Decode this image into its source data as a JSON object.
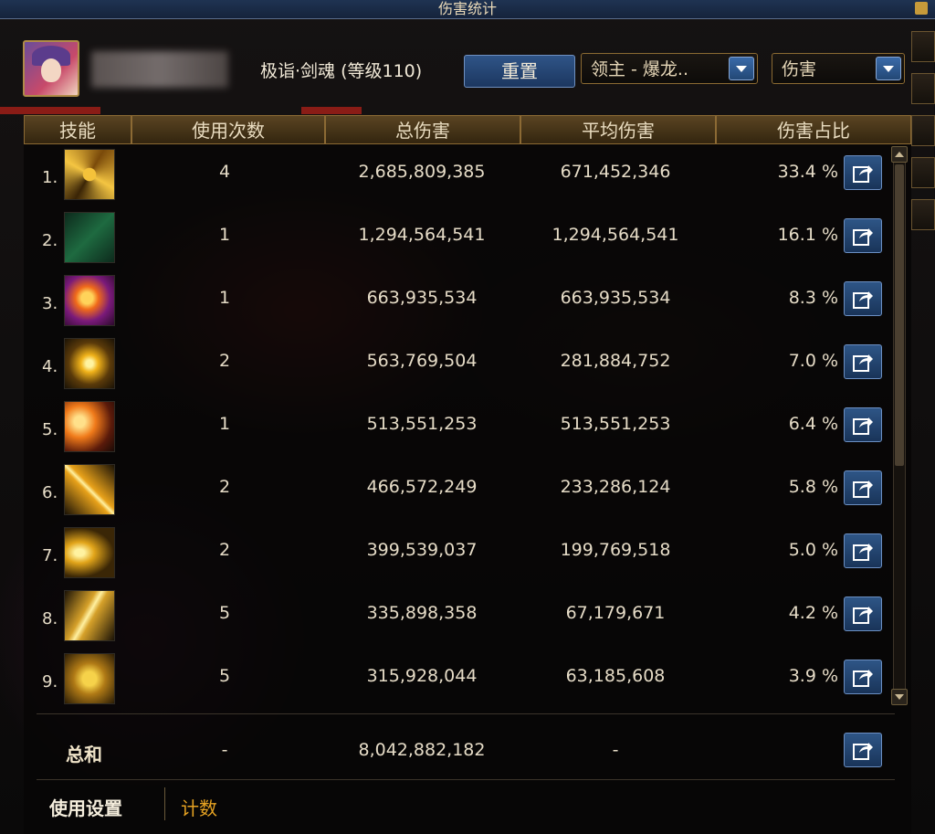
{
  "window": {
    "title": "伤害统计"
  },
  "character": {
    "name": "极诣·剑魂 (等级110)"
  },
  "header": {
    "reset_label": "重置",
    "target_dropdown": "领主 - 爆龙..",
    "stat_dropdown": "伤害"
  },
  "table": {
    "columns": [
      "技能",
      "使用次数",
      "总伤害",
      "平均伤害",
      "伤害占比"
    ],
    "rows": [
      {
        "index": "1.",
        "icon": "golden-slash-swirl-icon",
        "uses": "4",
        "total": "2,685,809,385",
        "avg": "671,452,346",
        "pct": "33.4 %"
      },
      {
        "index": "2.",
        "icon": "green-glyph-icon",
        "uses": "1",
        "total": "1,294,564,541",
        "avg": "1,294,564,541",
        "pct": "16.1 %"
      },
      {
        "index": "3.",
        "icon": "purple-burst-icon",
        "uses": "1",
        "total": "663,935,534",
        "avg": "663,935,534",
        "pct": "8.3 %"
      },
      {
        "index": "4.",
        "icon": "yellow-star-burst-icon",
        "uses": "2",
        "total": "563,769,504",
        "avg": "281,884,752",
        "pct": "7.0 %"
      },
      {
        "index": "5.",
        "icon": "orange-fan-slash-icon",
        "uses": "1",
        "total": "513,551,253",
        "avg": "513,551,253",
        "pct": "6.4 %"
      },
      {
        "index": "6.",
        "icon": "sword-flash-icon",
        "uses": "2",
        "total": "466,572,249",
        "avg": "233,286,124",
        "pct": "5.8 %"
      },
      {
        "index": "7.",
        "icon": "crescent-wave-icon",
        "uses": "2",
        "total": "399,539,037",
        "avg": "199,769,518",
        "pct": "5.0 %"
      },
      {
        "index": "8.",
        "icon": "lightning-flow-icon",
        "uses": "5",
        "total": "335,898,358",
        "avg": "67,179,671",
        "pct": "4.2 %"
      },
      {
        "index": "9.",
        "icon": "dragon-head-icon",
        "uses": "5",
        "total": "315,928,044",
        "avg": "63,185,608",
        "pct": "3.9 %"
      }
    ],
    "share_icon": "share-export-icon"
  },
  "summary": {
    "label": "总和",
    "uses": "-",
    "total": "8,042,882,182",
    "avg": "-"
  },
  "footer_tabs": {
    "settings": "使用设置",
    "count": "计数"
  },
  "colors": {
    "accent_gold": "#e7a322",
    "button_blue": "#2e5586",
    "header_brown": "#5a4422"
  }
}
